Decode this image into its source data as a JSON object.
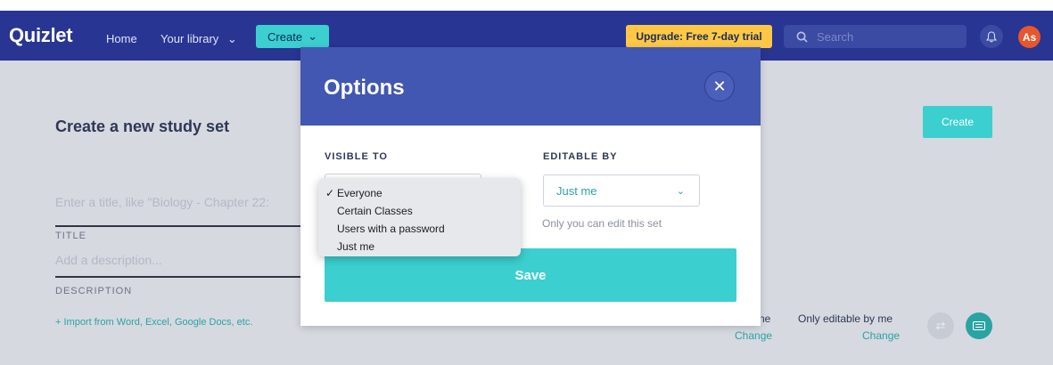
{
  "navbar": {
    "logo": "Quizlet",
    "home": "Home",
    "library": "Your library",
    "library_chevron": "⌄",
    "create": "Create",
    "create_chevron": "⌄",
    "upgrade": "Upgrade: Free 7-day trial",
    "search_placeholder": "Search",
    "bell_icon": "🔔",
    "avatar": "As"
  },
  "page": {
    "title": "Create a new study set",
    "create_button": "Create",
    "title_placeholder": "Enter a title, like \"Biology - Chapter 22:",
    "title_label": "TITLE",
    "description_placeholder": "Add a description...",
    "description_label": "DESCRIPTION",
    "import_link": "+ Import from Word, Excel, Google Docs, etc.",
    "visibility_fragment": "ne",
    "change_1": "Change",
    "editable_text": "Only editable by me",
    "change_2": "Change"
  },
  "modal": {
    "title": "Options",
    "close_icon": "✕",
    "visible_to_label": "VISIBLE TO",
    "editable_by_label": "EDITABLE BY",
    "editable_by_value": "Just me",
    "editable_chevron": "⌄",
    "helper_text": "Only you can edit this set",
    "save_label": "Save"
  },
  "dropdown": {
    "check": "✓",
    "options": [
      "Everyone",
      "Certain Classes",
      "Users with a password",
      "Just me"
    ],
    "selected": "Everyone"
  },
  "colors": {
    "navbar": "#283593",
    "modal_header": "#4257b2",
    "accent": "#3ccfcf",
    "upgrade": "#ffc844",
    "avatar": "#e8562d"
  }
}
